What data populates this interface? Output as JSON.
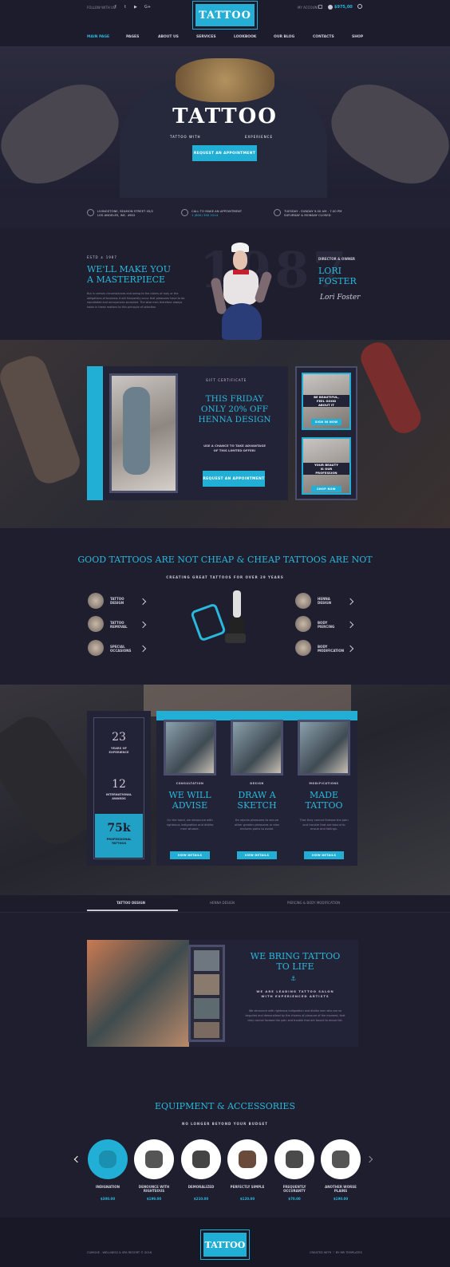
{
  "header": {
    "follow_label": "FOLLOW WITH US:",
    "social": [
      "f",
      "t",
      "▶",
      "G+"
    ],
    "logo_text": "TATTOO",
    "account_label": "MY ACCOUNT",
    "cart_total": "$975,00",
    "nav": [
      "MAIN PAGE",
      "PAGES",
      "ABOUT US",
      "SERVICES",
      "LOOKBOOK",
      "OUR BLOG",
      "CONTACTS",
      "SHOP"
    ]
  },
  "hero": {
    "title": "TATTOO",
    "tagline_left": "TATTOO WITH",
    "tagline_right": "EXPERIENCE",
    "cta": "REQUEST AN APPOINTMENT"
  },
  "info": {
    "address_line1": "LIVINGSTONE, SEAMON STREET 45/2",
    "address_line2": "LOS ANGELES, INC. 4902",
    "call_line1": "CALL TO MAKE AN APPOINTMENT",
    "call_line2": "1 (800) 300 2214",
    "hours_line1": "TUESDAY - SUNDAY 9.00 AM - 7.00 PM",
    "hours_line2": "SATURDAY & MONDAY CLOSED"
  },
  "about": {
    "estd": "ESTD ⚓ 1987",
    "title_line1": "WE'LL MAKE YOU",
    "title_line2": "A MASTERPIECE",
    "body": "But in certain circumstances and owing to the claims of duty or the obligations of business it will frequently occur that pleasures have to be repudiated and annoyances accepted. The wise man therefore always holds in these matters to this principle of selection.",
    "big_year": "1987",
    "role": "DIRECTOR & OWNER",
    "name_line1": "LORI",
    "name_line2": "FOSTER",
    "signature": "Lori Foster"
  },
  "gift": {
    "label": "GIFT CERTIFICATE",
    "title_line1": "THIS FRIDAY",
    "title_line2": "ONLY 20% OFF",
    "title_line3": "HENNA DESIGN",
    "sub_line1": "USE A CHANCE TO TAKE ADVANTAGE",
    "sub_line2": "OF THIS LIMITED OFFER!",
    "cta": "REQUEST AN APPOINTMENT",
    "side1_line1": "BE BEAUTIFUL,",
    "side1_line2": "FEEL GOOD",
    "side1_line3": "ABOUT IT",
    "side1_btn": "SIGN IN NOW",
    "side2_line1": "YOUR BEAUTY",
    "side2_line2": "IS OUR",
    "side2_line3": "PROFESSION",
    "side2_btn": "SHOP NOW"
  },
  "services": {
    "title": "GOOD TATTOOS ARE NOT CHEAP & CHEAP TATTOOS ARE NOT",
    "subtitle": "CREATING GREAT TATTOOS FOR OVER 29 YEARS",
    "left": [
      {
        "l1": "TATTOO",
        "l2": "DESIGN"
      },
      {
        "l1": "TATTOO",
        "l2": "REMOVAL"
      },
      {
        "l1": "SPECIAL",
        "l2": "OCCASIONS"
      }
    ],
    "right": [
      {
        "l1": "HENNA",
        "l2": "DESIGN"
      },
      {
        "l1": "BODY",
        "l2": "PIERCING"
      },
      {
        "l1": "BODY",
        "l2": "MODIFICATION"
      }
    ]
  },
  "stats": {
    "s1_num": "23",
    "s1_l1": "YEARS OF",
    "s1_l2": "EXPERIENCE",
    "s2_num": "12",
    "s2_l1": "INTERNATIONAL",
    "s2_l2": "AWARDS",
    "s3_num": "75k",
    "s3_l1": "PROFESSIONAL",
    "s3_l2": "TATTOOS"
  },
  "cards": [
    {
      "sub": "CONSULTATION",
      "t1": "WE WILL",
      "t2": "ADVISE",
      "body": "On the hand, we denounce with righteous indignation and dislike men whoare.",
      "btn": "VIEW DETAILS"
    },
    {
      "sub": "DESIGN",
      "t1": "DRAW A",
      "t2": "SKETCH",
      "body": "He rejects pleasures to secure other greater pleasures or else endures pains to avoid.",
      "btn": "VIEW DETAILS"
    },
    {
      "sub": "MODIFICATIONS",
      "t1": "MADE",
      "t2": "TATTOO",
      "body": "That they cannot foresee the pain and trouble that are bound to ensue and failings.",
      "btn": "VIEW DETAILS"
    }
  ],
  "tabs": [
    "TATTOO DESIGN",
    "HENNA DESIGN",
    "PIERCING & BODY MODIFICATION"
  ],
  "bring": {
    "title_line1": "WE BRING TATTOO",
    "title_line2": "TO LIFE",
    "sub_line1": "WE ARE LEADING TATTOO SALON",
    "sub_line2": "WITH EXPERIENCED ARTISTS",
    "body": "We denounce with righteous indignation and dislike men who are so beguiled and demoralized by the charms of pleasure of the moment, that they cannot foresee the pain and trouble that are bound to ensue fail."
  },
  "equipment": {
    "title": "EQUIPMENT & ACCESSORIES",
    "subtitle": "NO LONGER BEYOND YOUR BUDGET",
    "products": [
      {
        "n1": "INDIGNATION",
        "n2": "",
        "price": "$300.00"
      },
      {
        "n1": "DENOUNCE WITH",
        "n2": "RIGHTEOUS",
        "price": "$199.00"
      },
      {
        "n1": "DEMORALIZED",
        "n2": "",
        "price": "$210.00"
      },
      {
        "n1": "PERFECTLY SIMPLE",
        "n2": "",
        "price": "$120.00"
      },
      {
        "n1": "FREQUENTLY",
        "n2": "OCCURANTY",
        "price": "$70.00"
      },
      {
        "n1": "ANOTHER WORSE",
        "n2": "PLAINS",
        "price": "$190.00"
      }
    ]
  },
  "footer": {
    "left": "CUMGUE - WELLNESS & SPA RESORT © 2016",
    "logo_text": "TATTOO",
    "right": "CREATED WITH ♡ BY MR TEMPLATES"
  },
  "colors": {
    "accent": "#22afd6",
    "bg": "#1f1e2f"
  }
}
